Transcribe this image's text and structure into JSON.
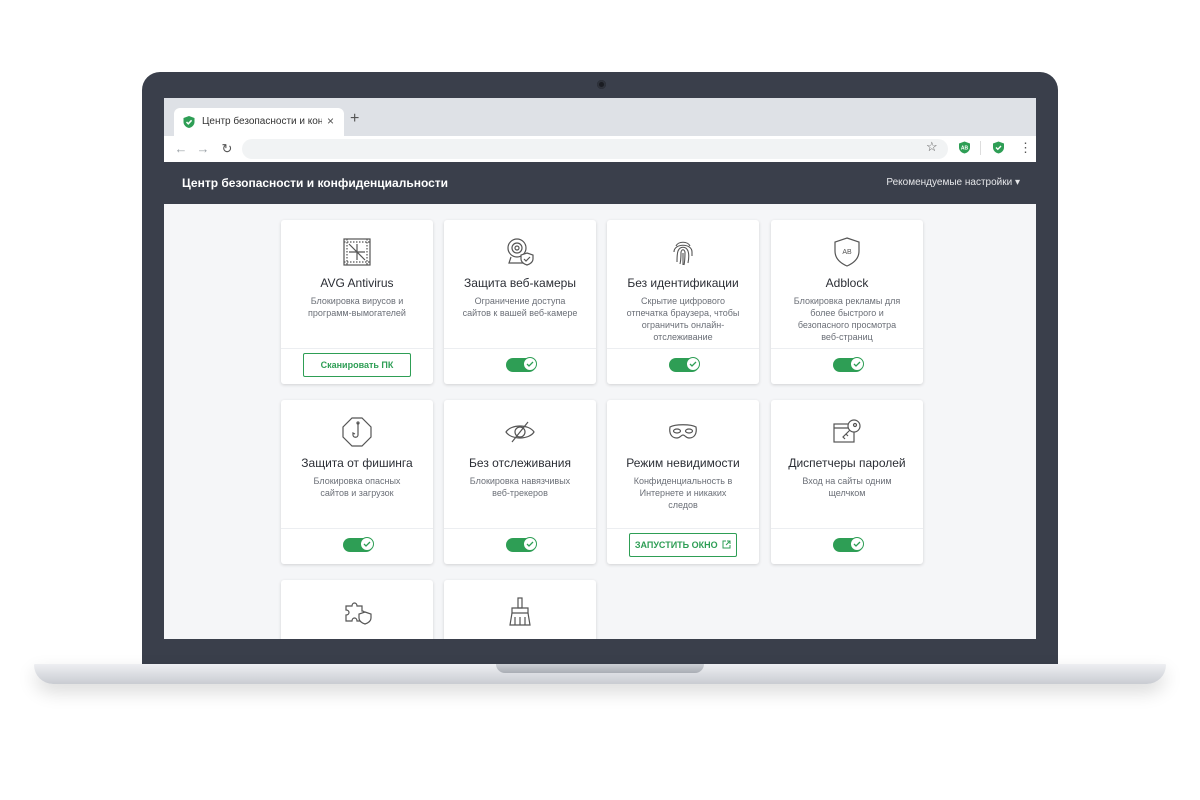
{
  "browser": {
    "tab_title": "Центр безопасности и конф...",
    "tab_close": "×",
    "new_tab": "+",
    "back": "←",
    "forward": "→",
    "reload": "↻",
    "bookmark_icon": "☆",
    "menu_icon": "⋮",
    "ext_ab_label": "AB"
  },
  "app": {
    "title": "Центр безопасности и конфиденциальности",
    "dropdown_label": "Рекомендуемые настройки ▾",
    "accent": "#2e9e55"
  },
  "cards": [
    {
      "icon": "antivirus-icon",
      "title": "AVG Antivirus",
      "desc": "Блокировка вирусов и программ-вымогателей",
      "action": "button",
      "button_label": "Сканировать ПК"
    },
    {
      "icon": "webcam-icon",
      "title": "Защита веб-камеры",
      "desc": "Ограничение доступа сайтов к вашей веб-камере",
      "action": "toggle",
      "enabled": true
    },
    {
      "icon": "fingerprint-icon",
      "title": "Без идентификации",
      "desc": "Скрытие цифрового отпечатка браузера, чтобы ограничить онлайн-отслеживание",
      "action": "toggle",
      "enabled": true
    },
    {
      "icon": "adblock-icon",
      "title": "Adblock",
      "icon_text": "AB",
      "desc": "Блокировка рекламы для более быстрого и безопасного просмотра веб-страниц",
      "action": "toggle",
      "enabled": true
    },
    {
      "icon": "phishing-icon",
      "title": "Защита от фишинга",
      "desc": "Блокировка опасных сайтов и загрузок",
      "action": "toggle",
      "enabled": true
    },
    {
      "icon": "eye-slash-icon",
      "title": "Без отслеживания",
      "desc": "Блокировка навязчивых веб-трекеров",
      "action": "toggle",
      "enabled": true
    },
    {
      "icon": "mask-icon",
      "title": "Режим невидимости",
      "desc": "Конфиденциальность в Интернете и никаких следов",
      "action": "button",
      "button_label": "ЗАПУСТИТЬ ОКНО"
    },
    {
      "icon": "password-key-icon",
      "title": "Диспетчеры паролей",
      "desc": "Вход на сайты одним щелчком",
      "action": "toggle",
      "enabled": true
    },
    {
      "icon": "extension-guard-icon",
      "title": "",
      "desc": "",
      "action": "none"
    },
    {
      "icon": "cleaner-brush-icon",
      "title": "",
      "desc": "",
      "action": "none"
    }
  ]
}
